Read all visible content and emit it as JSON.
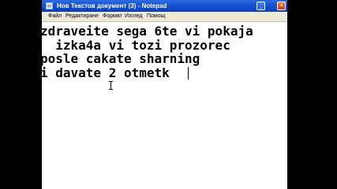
{
  "window": {
    "title": "Нов Текстов документ (3) - Notepad",
    "minimize_glyph": "_",
    "maximize_glyph": "□",
    "close_glyph": "✕"
  },
  "menu": {
    "items": [
      {
        "label": "Файл"
      },
      {
        "label": "Редактиране"
      },
      {
        "label": "Формат"
      },
      {
        "label": "Изглед"
      },
      {
        "label": "Помощ"
      }
    ]
  },
  "document": {
    "lines": [
      "zdraveite sega 6te vi pokaja",
      "  izka4a vi tozi prozorec",
      "posle cakate sharning",
      "i davate 2 otmetk"
    ]
  },
  "colors": {
    "titlebar": "#0a3fb8",
    "menubar": "#ece9d8",
    "editor_bg": "#ffffff",
    "text": "#000000"
  }
}
